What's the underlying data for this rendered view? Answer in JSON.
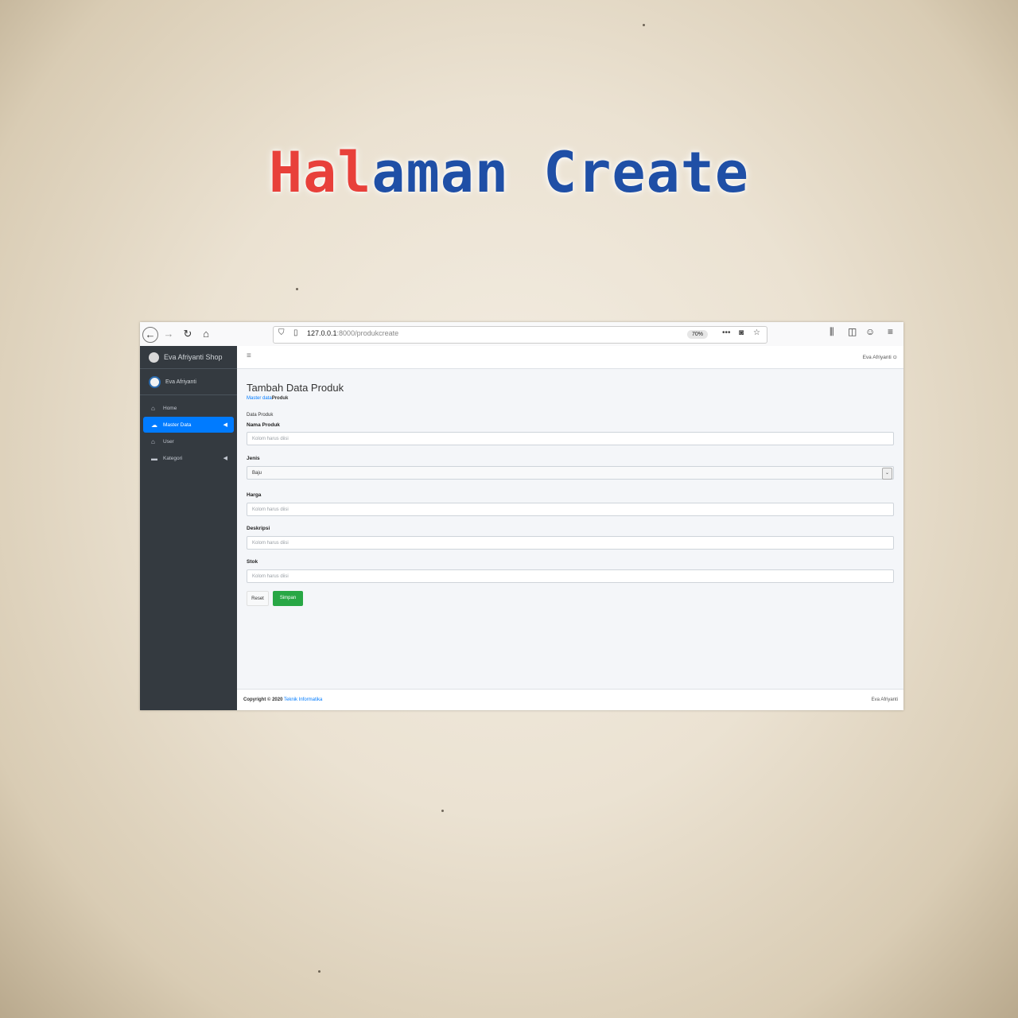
{
  "headline": {
    "part1": "Hal",
    "part2": "aman Create"
  },
  "browser": {
    "url_host": "127.0.0.1",
    "url_path": ":8000/produkcreate",
    "zoom": "70%"
  },
  "sidebar": {
    "brand": "Eva Afriyanti Shop",
    "user": "Eva Afriyanti",
    "items": [
      {
        "label": "Home",
        "icon": "home-icon"
      },
      {
        "label": "Master Data",
        "icon": "cloud-icon"
      },
      {
        "label": "User",
        "icon": "home-icon"
      },
      {
        "label": "Kategori",
        "icon": "folder-icon"
      }
    ]
  },
  "topnav": {
    "user": "Eva Afriyanti"
  },
  "page": {
    "title": "Tambah Data Produk",
    "breadcrumb_link": "Master data",
    "breadcrumb_current": "Produk",
    "section": "Data Produk"
  },
  "form": {
    "nama_label": "Nama Produk",
    "nama_placeholder": "Kolom harus diisi",
    "jenis_label": "Jenis",
    "jenis_value": "Baju",
    "harga_label": "Harga",
    "harga_placeholder": "Kolom harus diisi",
    "deskripsi_label": "Deskripsi",
    "deskripsi_placeholder": "Kolom harus diisi",
    "stok_label": "Stok",
    "stok_placeholder": "Kolom harus diisi",
    "reset_label": "Reset",
    "save_label": "Simpan"
  },
  "footer": {
    "copyright": "Copyright © 2020",
    "org": "Teknik Informatika",
    "right": "Eva Afriyanti"
  },
  "colors": {
    "accent": "#007bff",
    "success": "#28a745",
    "sidebar": "#343a40",
    "title_red": "#e8403a",
    "title_blue": "#1f4fa6"
  }
}
